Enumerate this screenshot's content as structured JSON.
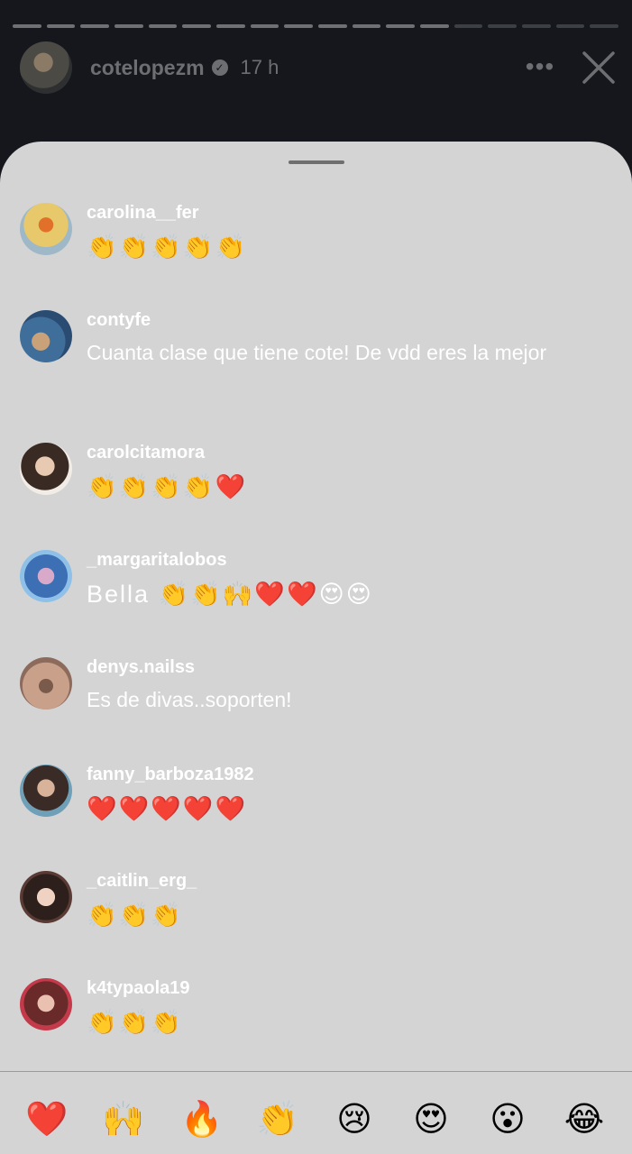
{
  "story": {
    "username": "cotelopezm",
    "time": "17 h",
    "progress_segments": 18,
    "progress_completed": 13,
    "more_glyph": "•••"
  },
  "comments": [
    {
      "username": "carolina__fer",
      "text": "👏👏👏👏👏"
    },
    {
      "username": "contyfe",
      "text": "Cuanta clase que tiene cote! De vdd eres la mejor"
    },
    {
      "username": "carolcitamora",
      "text": "👏👏👏👏❤️"
    },
    {
      "username": "_margaritalobos",
      "text": "Bella 👏👏🙌❤️❤️😍😍"
    },
    {
      "username": "denys.nailss",
      "text": "Es de divas..soporten!"
    },
    {
      "username": "fanny_barboza1982",
      "text": "❤️❤️❤️❤️❤️"
    },
    {
      "username": "_caitlin_erg_",
      "text": "👏👏👏"
    },
    {
      "username": "k4typaola19",
      "text": "👏👏👏"
    }
  ],
  "reactions": [
    "❤️",
    "🙌",
    "🔥",
    "👏",
    "😢",
    "😍",
    "😮",
    "😂"
  ],
  "colors": {
    "background": "#15171c",
    "sheet": "#d4d4d4",
    "text": "#ffffff",
    "header_text": "#6c6e72"
  }
}
